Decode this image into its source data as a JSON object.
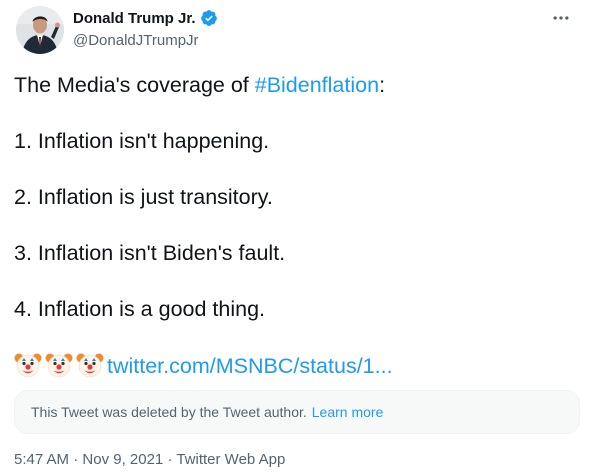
{
  "author": {
    "display_name": "Donald Trump Jr.",
    "handle": "@DonaldJTrumpJr",
    "verified": true,
    "avatar_icon": "profile-photo"
  },
  "more_icon": "more-horizontal-icon",
  "tweet": {
    "line1_prefix": "The Media's coverage of ",
    "hashtag": "#Bidenflation",
    "line1_suffix": ":",
    "items": [
      "1. Inflation isn't happening.",
      "2. Inflation is just transitory.",
      "3. Inflation isn't Biden's fault.",
      "4. Inflation is a good thing."
    ],
    "emoji_icons": [
      "clown-face-emoji",
      "clown-face-emoji",
      "clown-face-emoji"
    ],
    "link": "twitter.com/MSNBC/status/1..."
  },
  "deleted_notice": {
    "text": "This Tweet was deleted by the Tweet author.",
    "learn_more": "Learn more"
  },
  "meta": {
    "time": "5:47 AM",
    "separator": " · ",
    "date": "Nov 9, 2021",
    "source": "Twitter Web App"
  },
  "colors": {
    "accent": "#1d9bf0",
    "text": "#0f1419",
    "secondary": "#536471",
    "card_bg": "#f7f9f9"
  }
}
